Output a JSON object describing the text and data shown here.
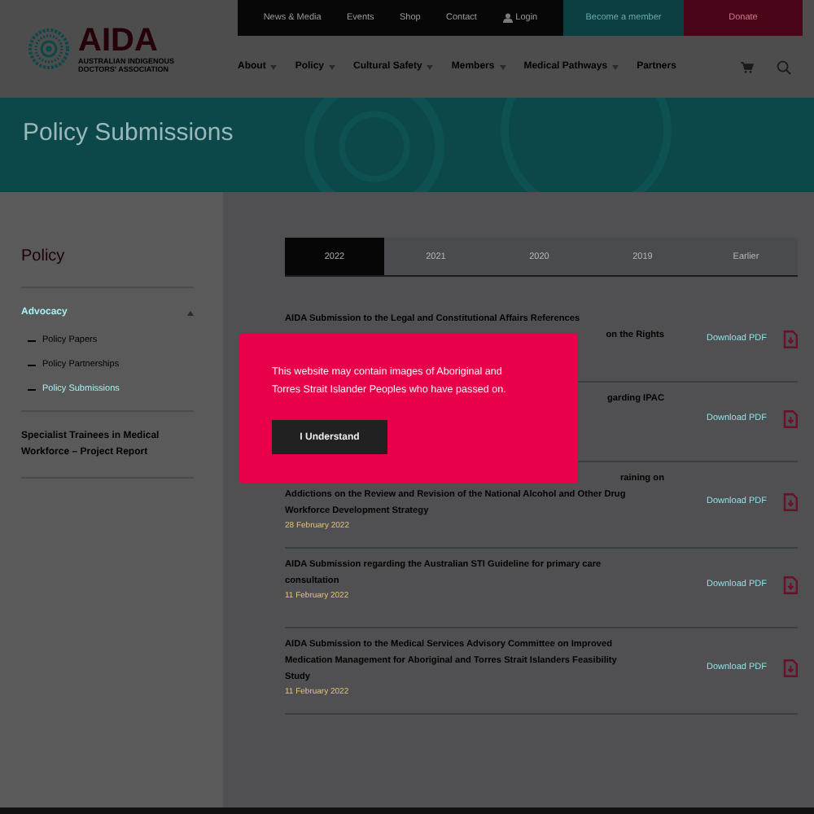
{
  "logo": {
    "name": "AIDA",
    "tagline": "AUSTRALIAN INDIGENOUS DOCTORS' ASSOCIATION"
  },
  "top_bar": {
    "links": [
      "News & Media",
      "Events",
      "Shop",
      "Contact"
    ],
    "login": "Login",
    "member_button": "Become a member",
    "donate_button": "Donate"
  },
  "nav": [
    {
      "label": "About",
      "dropdown": true
    },
    {
      "label": "Policy",
      "dropdown": true
    },
    {
      "label": "Cultural Safety",
      "dropdown": true
    },
    {
      "label": "Members",
      "dropdown": true
    },
    {
      "label": "Medical Pathways",
      "dropdown": true
    },
    {
      "label": "Partners",
      "dropdown": false
    }
  ],
  "banner": {
    "title": "Policy Submissions"
  },
  "sidebar": {
    "title": "Policy",
    "groups": [
      {
        "label": "Advocacy",
        "expanded": true,
        "children": [
          {
            "label": "Policy Papers",
            "selected": false
          },
          {
            "label": "Policy Partnerships",
            "selected": false
          },
          {
            "label": "Policy Submissions",
            "selected": true
          }
        ]
      },
      {
        "label": "Specialist Trainees in Medical Workforce – Project Report",
        "expanded": false
      }
    ]
  },
  "tabs": [
    {
      "label": "2022",
      "selected": true
    },
    {
      "label": "2021",
      "selected": false
    },
    {
      "label": "2020",
      "selected": false
    },
    {
      "label": "2019",
      "selected": false
    },
    {
      "label": "Earlier",
      "selected": false
    }
  ],
  "submissions": [
    {
      "lines": [
        {
          "text": "AIDA Submission to the Legal and Constitutional Affairs References",
          "kind": "full"
        },
        {
          "text": "on the Rights",
          "kind": "tail"
        }
      ],
      "download": "Download PDF"
    },
    {
      "lines": [
        {
          "text": "garding IPAC",
          "kind": "tail"
        }
      ],
      "download": "Download PDF"
    },
    {
      "lines": [
        {
          "text": "raining on",
          "kind": "tail"
        },
        {
          "text": "Addictions on the Review and Revision of the National Alcohol and Other Drug",
          "kind": "full"
        },
        {
          "text": "Workforce Development Strategy",
          "kind": "full"
        }
      ],
      "date": "28 February 2022",
      "download": "Download PDF"
    },
    {
      "lines": [
        {
          "text": "AIDA Submission regarding the Australian STI Guideline for primary care",
          "kind": "full"
        },
        {
          "text": "consultation",
          "kind": "full"
        }
      ],
      "date": "11 February 2022",
      "download": "Download PDF"
    },
    {
      "lines": [
        {
          "text": "AIDA Submission to the Medical Services Advisory Committee on Improved",
          "kind": "full"
        },
        {
          "text": "Medication Management for Aboriginal and Torres Strait Islanders Feasibility",
          "kind": "full"
        },
        {
          "text": "Study",
          "kind": "full"
        }
      ],
      "date": "11 February 2022",
      "download": "Download PDF"
    }
  ],
  "modal": {
    "message": "This website may contain images of Aboriginal and Torres Strait Islander Peoples who have passed on.",
    "button": "I Understand"
  }
}
